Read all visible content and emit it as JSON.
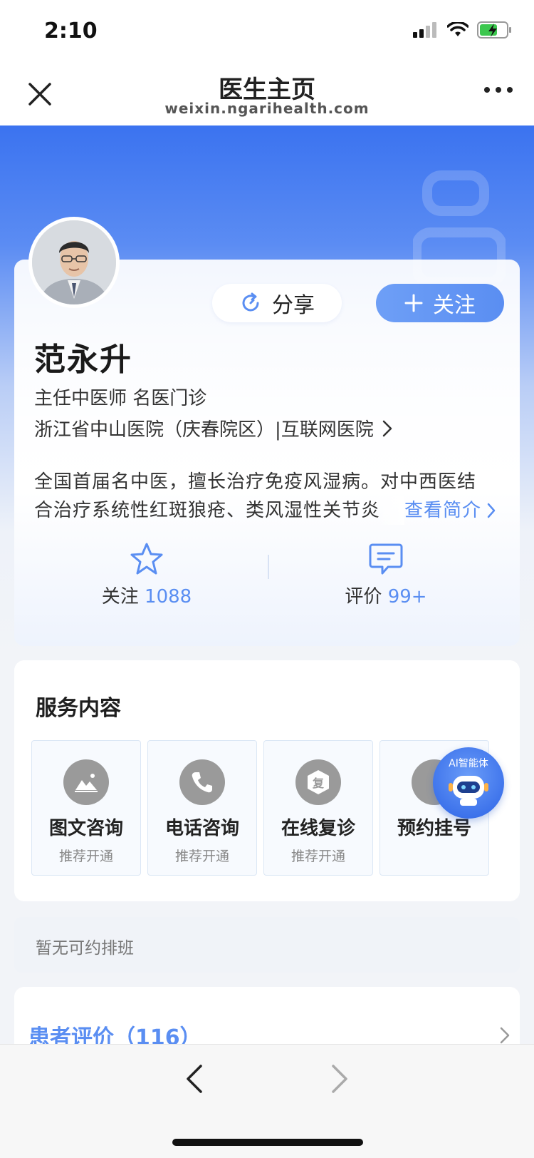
{
  "status_bar": {
    "time": "2:10"
  },
  "nav": {
    "title": "医生主页",
    "subtitle": "weixin.ngarihealth.com"
  },
  "profile": {
    "share_label": "分享",
    "follow_label": "关注",
    "name": "范永升",
    "title": "主任中医师  名医门诊",
    "hospital": "浙江省中山医院（庆春院区）|互联网医院",
    "intro_line1": "全国首届名中医，擅长治疗免疫风湿病。对中西医结",
    "intro_line2": "合治疗系统性红斑狼疮、类风湿性关节炎",
    "intro_more": "查看简介",
    "stats": {
      "follow_label": "关注",
      "follow_count": "1088",
      "review_label": "评价",
      "review_count": "99+"
    }
  },
  "services": {
    "title": "服务内容",
    "items": [
      {
        "name": "图文咨询",
        "status": "推荐开通",
        "icon": "image-text-icon"
      },
      {
        "name": "电话咨询",
        "status": "推荐开通",
        "icon": "phone-icon"
      },
      {
        "name": "在线复诊",
        "status": "推荐开通",
        "icon": "revisit-icon",
        "icon_text": "复"
      },
      {
        "name": "预约挂号",
        "status": "",
        "icon": "appointment-icon"
      }
    ],
    "ai_agent_label": "AI智能体"
  },
  "schedule": {
    "text": "暂无可约排班"
  },
  "reviews": {
    "title": "患者评价（116）"
  },
  "colors": {
    "accent": "#5a8ef2",
    "hero_top": "#3b73f0"
  }
}
